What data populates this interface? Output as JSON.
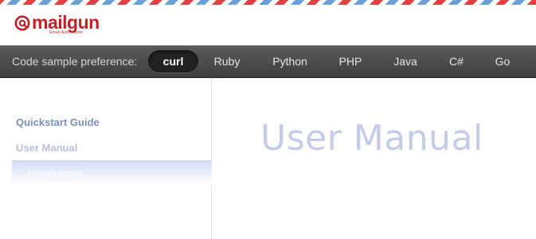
{
  "brand": {
    "name": "mailgun",
    "tagline": "Email Automation",
    "color": "#c02227"
  },
  "navbar": {
    "label": "Code sample preference:",
    "languages": [
      "curl",
      "Ruby",
      "Python",
      "PHP",
      "Java",
      "C#",
      "Go"
    ],
    "selected": "curl"
  },
  "sidebar": {
    "quickstart": "Quickstart Guide",
    "user_manual": "User Manual",
    "introduction": "Introduction"
  },
  "main": {
    "title": "User Manual"
  },
  "colors": {
    "nav_bg": "#4a4a4a",
    "link_primary": "#7f8fb8",
    "link_muted": "#b8c0d8",
    "title": "#c3cbe7"
  }
}
